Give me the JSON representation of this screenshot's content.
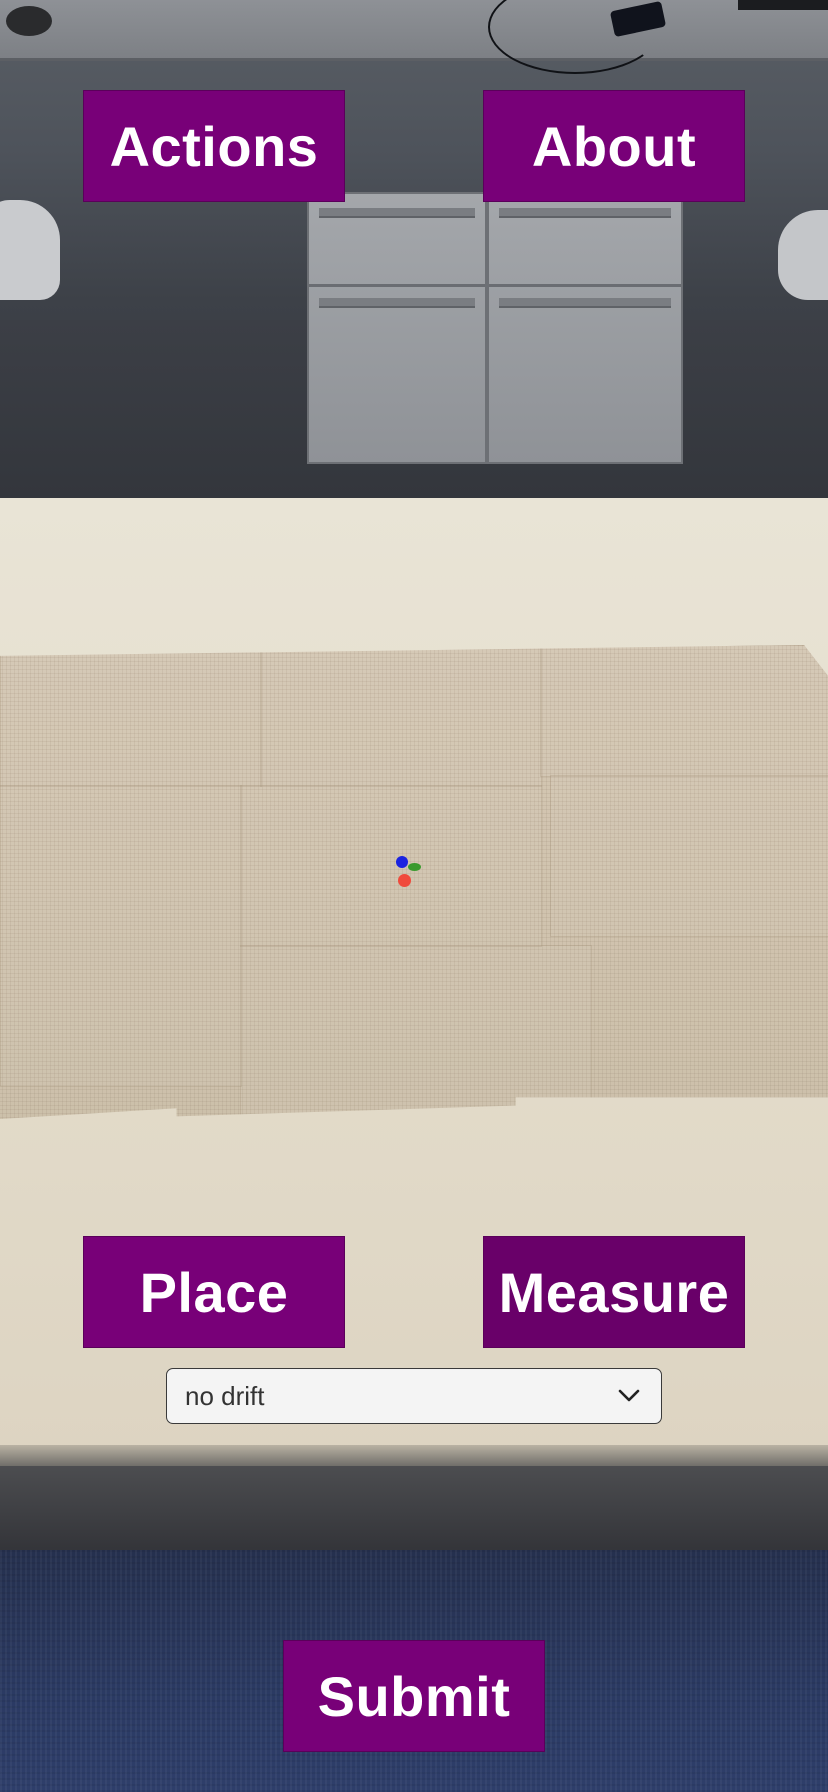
{
  "toolbar": {
    "actions_label": "Actions",
    "about_label": "About"
  },
  "controls": {
    "place_label": "Place",
    "measure_label": "Measure",
    "drift_select": {
      "selected": "no drift"
    },
    "submit_label": "Submit"
  },
  "colors": {
    "button_bg": "#780078",
    "button_text": "#ffffff",
    "select_bg": "#f4f4f4"
  },
  "icons": {
    "dropdown": "chevron-down-icon",
    "marker": "ar-origin-marker"
  }
}
